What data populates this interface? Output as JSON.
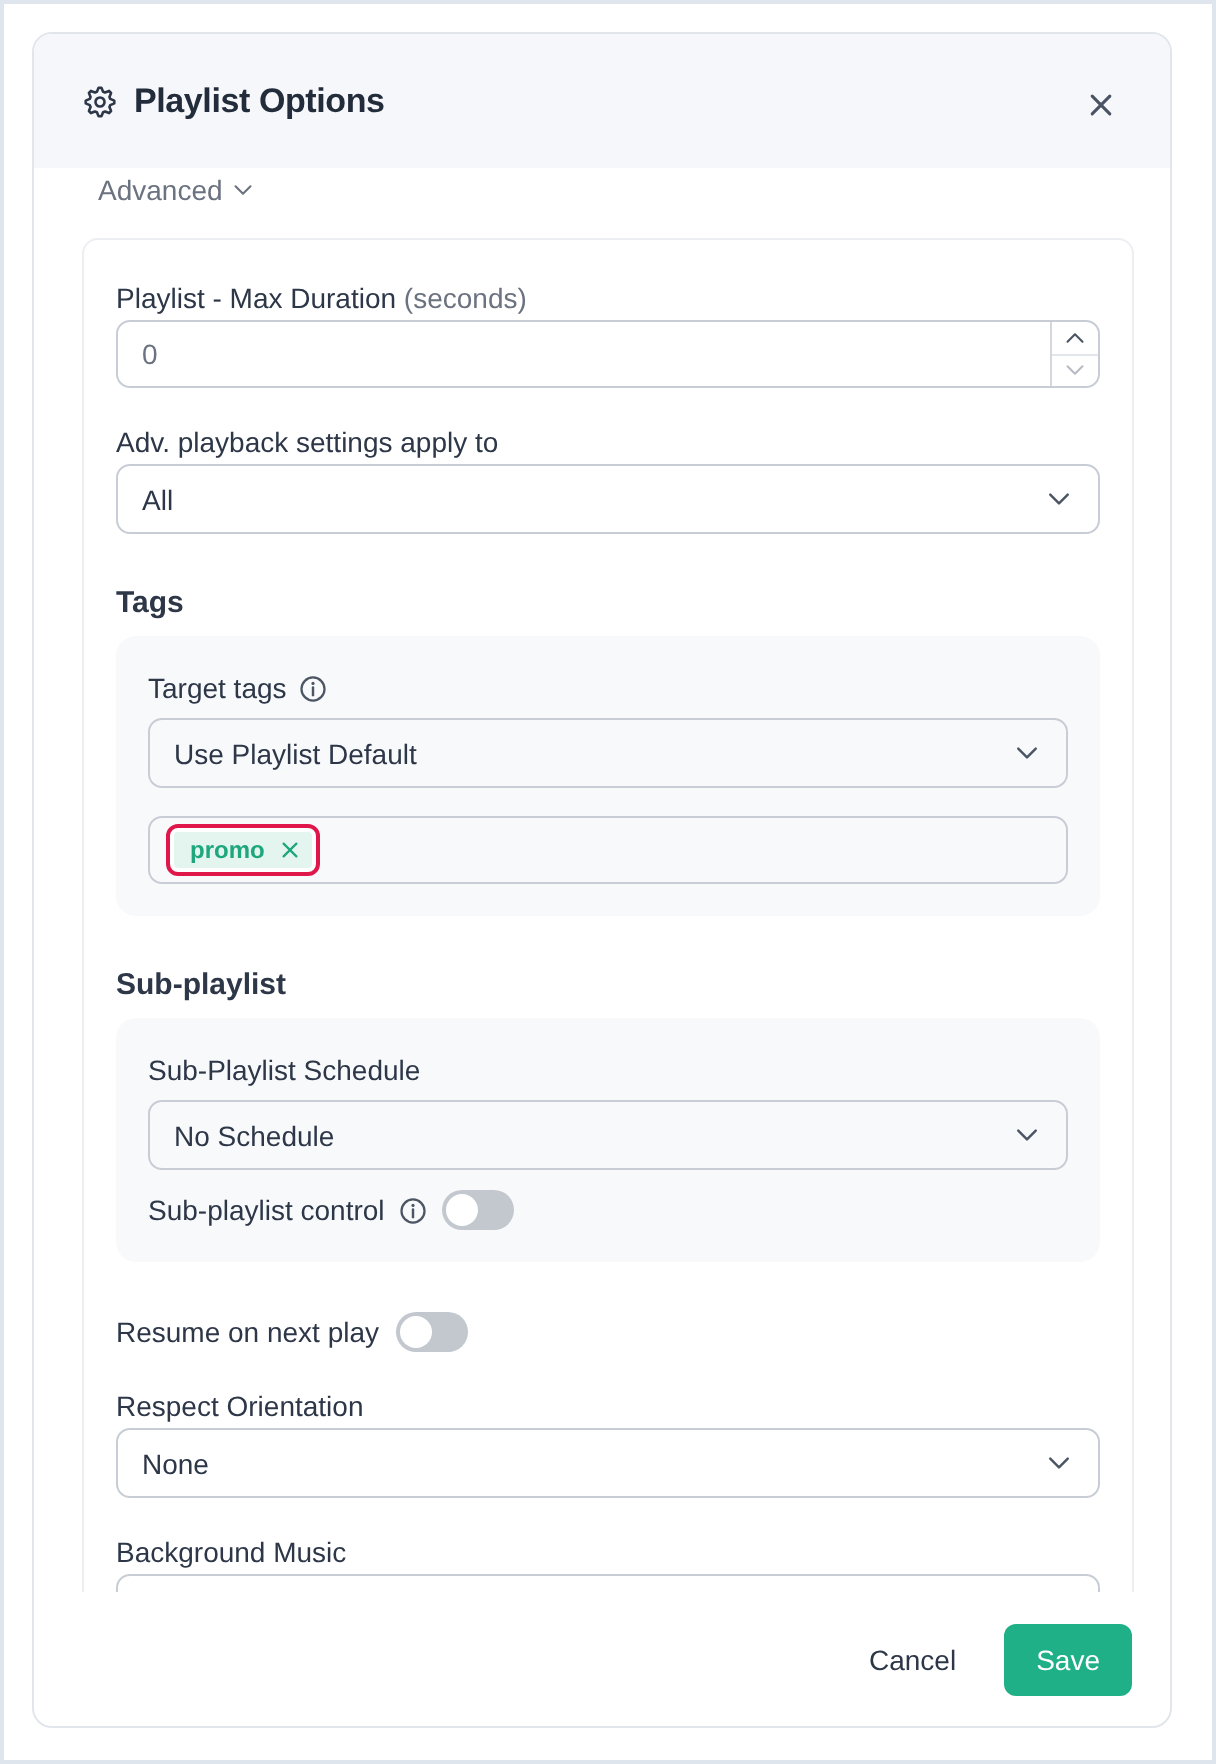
{
  "window": {
    "title": "Playlist Options"
  },
  "advanced": {
    "label": "Advanced",
    "expanded": true
  },
  "fields": [
    {
      "kind": "number",
      "label": "Playlist - Max Duration",
      "hint": "(seconds)",
      "placeholder": "0",
      "decrement_disabled": true
    },
    {
      "kind": "select",
      "label": "Adv. playback settings apply to",
      "value": "All"
    },
    {
      "kind": "group",
      "title": "Tags",
      "fields": [
        {
          "kind": "select",
          "label": "Target tags",
          "info": true,
          "value": "Use Playlist Default"
        },
        {
          "kind": "tags",
          "tags": [
            {
              "label": "promo",
              "focused": true
            }
          ]
        }
      ]
    },
    {
      "kind": "group",
      "title": "Sub-playlist",
      "fields": [
        {
          "kind": "select",
          "label": "Sub-Playlist Schedule",
          "value": "No Schedule"
        },
        {
          "kind": "toggle",
          "label": "Sub-playlist control",
          "info": true,
          "on": false
        }
      ]
    },
    {
      "kind": "toggle",
      "label": "Resume on next play",
      "on": false
    },
    {
      "kind": "select",
      "label": "Respect Orientation",
      "value": "None"
    },
    {
      "kind": "input",
      "label": "Background Music"
    }
  ],
  "buttons": [
    {
      "label": "Cancel",
      "kind": "secondary"
    },
    {
      "label": "Save",
      "kind": "primary"
    }
  ]
}
